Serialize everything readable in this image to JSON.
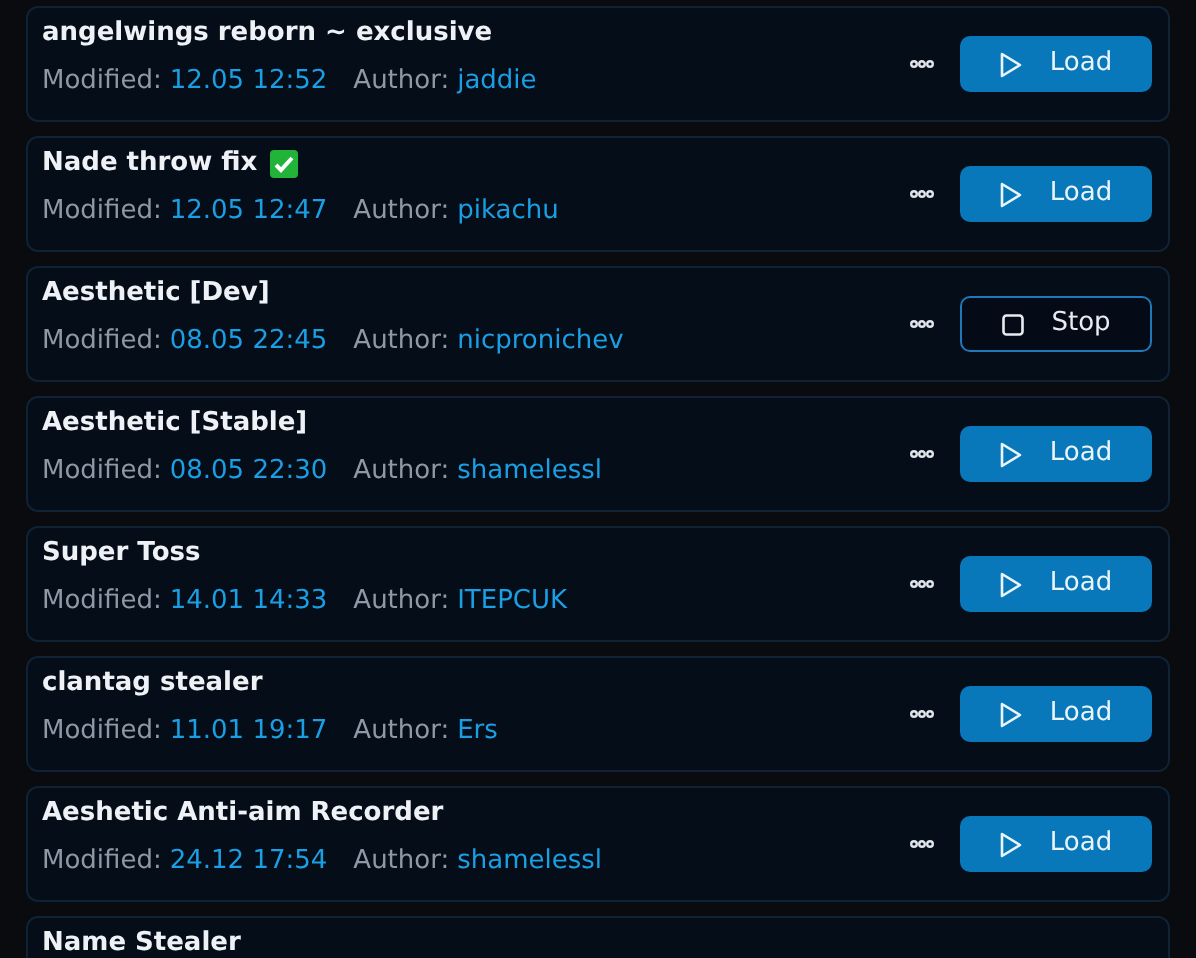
{
  "scripts": [
    {
      "name": "angelwings reborn ~ exclusive",
      "verified": false,
      "modified_label": "Modified:",
      "modified": "12.05 12:52",
      "author_label": "Author:",
      "author": "jaddie",
      "running": false,
      "button": "Load"
    },
    {
      "name": "Nade throw fix",
      "verified": true,
      "modified_label": "Modified:",
      "modified": "12.05 12:47",
      "author_label": "Author:",
      "author": "pikachu",
      "running": false,
      "button": "Load"
    },
    {
      "name": "Aesthetic [Dev]",
      "verified": false,
      "modified_label": "Modified:",
      "modified": "08.05 22:45",
      "author_label": "Author:",
      "author": "nicpronichev",
      "running": true,
      "button": "Stop"
    },
    {
      "name": "Aesthetic [Stable]",
      "verified": false,
      "modified_label": "Modified:",
      "modified": "08.05 22:30",
      "author_label": "Author:",
      "author": "shamelessl",
      "running": false,
      "button": "Load"
    },
    {
      "name": "Super Toss",
      "verified": false,
      "modified_label": "Modified:",
      "modified": "14.01 14:33",
      "author_label": "Author:",
      "author": "ITEPCUK",
      "running": false,
      "button": "Load"
    },
    {
      "name": "clantag stealer",
      "verified": false,
      "modified_label": "Modified:",
      "modified": "11.01 19:17",
      "author_label": "Author:",
      "author": "Ers",
      "running": false,
      "button": "Load"
    },
    {
      "name": "Aeshetic Anti-aim Recorder",
      "verified": false,
      "modified_label": "Modified:",
      "modified": "24.12 17:54",
      "author_label": "Author:",
      "author": "shamelessl",
      "running": false,
      "button": "Load"
    },
    {
      "name": "Name Stealer"
    }
  ]
}
